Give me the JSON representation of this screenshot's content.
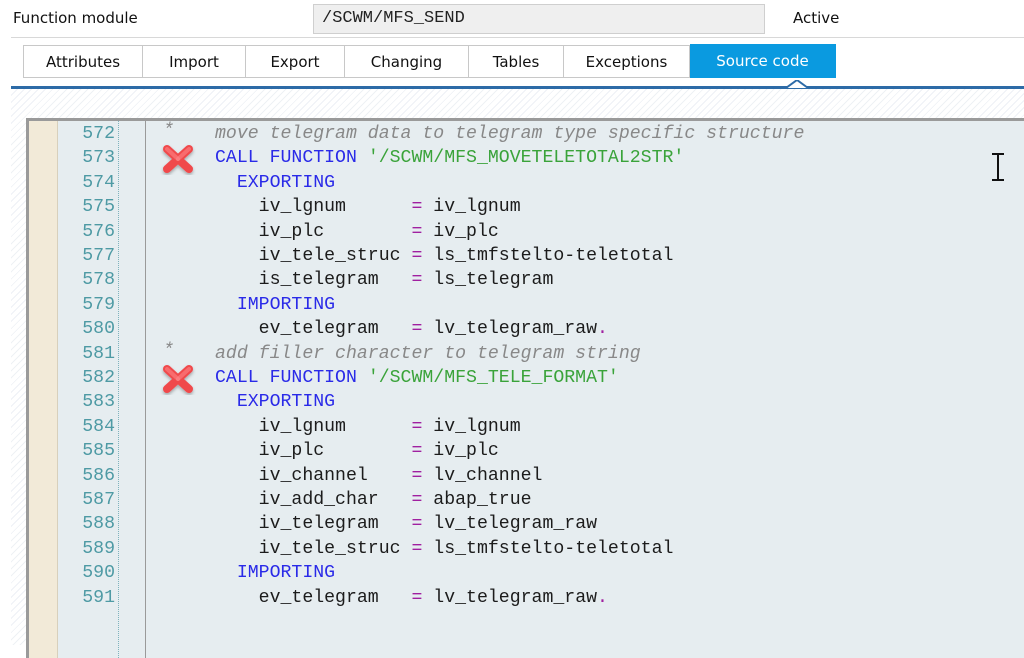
{
  "header": {
    "label": "Function module",
    "module_name": "/SCWM/MFS_SEND",
    "status": "Active"
  },
  "tabs": [
    {
      "label": "Attributes",
      "active": false
    },
    {
      "label": "Import",
      "active": false
    },
    {
      "label": "Export",
      "active": false
    },
    {
      "label": "Changing",
      "active": false
    },
    {
      "label": "Tables",
      "active": false
    },
    {
      "label": "Exceptions",
      "active": false
    },
    {
      "label": "Source code",
      "active": true
    }
  ],
  "colors": {
    "active_tab": "#0a9ae0",
    "tab_underline": "#2d6ba7",
    "keyword": "#2a2ae8",
    "string": "#3aa33a",
    "comment": "#888888",
    "operator": "#a020a0",
    "line_number": "#4e9aa4",
    "breakpoint": "#f0484c"
  },
  "editor": {
    "lines": [
      {
        "num": "572",
        "comment_star": true,
        "breakpoint": false,
        "tokens": [
          {
            "t": "cmt",
            "v": "move telegram data to telegram type specific structure"
          }
        ]
      },
      {
        "num": "573",
        "comment_star": false,
        "breakpoint": true,
        "tokens": [
          {
            "t": "kw",
            "v": "CALL FUNCTION "
          },
          {
            "t": "str",
            "v": "'/SCWM/MFS_MOVETELETOTAL2STR'"
          }
        ]
      },
      {
        "num": "574",
        "comment_star": false,
        "breakpoint": false,
        "tokens": [
          {
            "t": "kw",
            "v": "  EXPORTING"
          }
        ]
      },
      {
        "num": "575",
        "comment_star": false,
        "breakpoint": false,
        "tokens": [
          {
            "t": "id",
            "v": "    iv_lgnum      "
          },
          {
            "t": "op",
            "v": "="
          },
          {
            "t": "id",
            "v": " iv_lgnum"
          }
        ]
      },
      {
        "num": "576",
        "comment_star": false,
        "breakpoint": false,
        "tokens": [
          {
            "t": "id",
            "v": "    iv_plc        "
          },
          {
            "t": "op",
            "v": "="
          },
          {
            "t": "id",
            "v": " iv_plc"
          }
        ]
      },
      {
        "num": "577",
        "comment_star": false,
        "breakpoint": false,
        "tokens": [
          {
            "t": "id",
            "v": "    iv_tele_struc "
          },
          {
            "t": "op",
            "v": "="
          },
          {
            "t": "id",
            "v": " ls_tmfstelto-teletotal"
          }
        ]
      },
      {
        "num": "578",
        "comment_star": false,
        "breakpoint": false,
        "tokens": [
          {
            "t": "id",
            "v": "    is_telegram   "
          },
          {
            "t": "op",
            "v": "="
          },
          {
            "t": "id",
            "v": " ls_telegram"
          }
        ]
      },
      {
        "num": "579",
        "comment_star": false,
        "breakpoint": false,
        "tokens": [
          {
            "t": "kw",
            "v": "  IMPORTING"
          }
        ]
      },
      {
        "num": "580",
        "comment_star": false,
        "breakpoint": false,
        "tokens": [
          {
            "t": "id",
            "v": "    ev_telegram   "
          },
          {
            "t": "op",
            "v": "="
          },
          {
            "t": "id",
            "v": " lv_telegram_raw"
          },
          {
            "t": "op",
            "v": "."
          }
        ]
      },
      {
        "num": "581",
        "comment_star": true,
        "breakpoint": false,
        "tokens": [
          {
            "t": "cmt",
            "v": "add filler character to telegram string"
          }
        ]
      },
      {
        "num": "582",
        "comment_star": false,
        "breakpoint": true,
        "tokens": [
          {
            "t": "kw",
            "v": "CALL FUNCTION "
          },
          {
            "t": "str",
            "v": "'/SCWM/MFS_TELE_FORMAT'"
          }
        ]
      },
      {
        "num": "583",
        "comment_star": false,
        "breakpoint": false,
        "tokens": [
          {
            "t": "kw",
            "v": "  EXPORTING"
          }
        ]
      },
      {
        "num": "584",
        "comment_star": false,
        "breakpoint": false,
        "tokens": [
          {
            "t": "id",
            "v": "    iv_lgnum      "
          },
          {
            "t": "op",
            "v": "="
          },
          {
            "t": "id",
            "v": " iv_lgnum"
          }
        ]
      },
      {
        "num": "585",
        "comment_star": false,
        "breakpoint": false,
        "tokens": [
          {
            "t": "id",
            "v": "    iv_plc        "
          },
          {
            "t": "op",
            "v": "="
          },
          {
            "t": "id",
            "v": " iv_plc"
          }
        ]
      },
      {
        "num": "586",
        "comment_star": false,
        "breakpoint": false,
        "tokens": [
          {
            "t": "id",
            "v": "    iv_channel    "
          },
          {
            "t": "op",
            "v": "="
          },
          {
            "t": "id",
            "v": " lv_channel"
          }
        ]
      },
      {
        "num": "587",
        "comment_star": false,
        "breakpoint": false,
        "tokens": [
          {
            "t": "id",
            "v": "    iv_add_char   "
          },
          {
            "t": "op",
            "v": "="
          },
          {
            "t": "id",
            "v": " abap_true"
          }
        ]
      },
      {
        "num": "588",
        "comment_star": false,
        "breakpoint": false,
        "tokens": [
          {
            "t": "id",
            "v": "    iv_telegram   "
          },
          {
            "t": "op",
            "v": "="
          },
          {
            "t": "id",
            "v": " lv_telegram_raw"
          }
        ]
      },
      {
        "num": "589",
        "comment_star": false,
        "breakpoint": false,
        "tokens": [
          {
            "t": "id",
            "v": "    iv_tele_struc "
          },
          {
            "t": "op",
            "v": "="
          },
          {
            "t": "id",
            "v": " ls_tmfstelto-teletotal"
          }
        ]
      },
      {
        "num": "590",
        "comment_star": false,
        "breakpoint": false,
        "tokens": [
          {
            "t": "kw",
            "v": "  IMPORTING"
          }
        ]
      },
      {
        "num": "591",
        "comment_star": false,
        "breakpoint": false,
        "tokens": [
          {
            "t": "id",
            "v": "    ev_telegram   "
          },
          {
            "t": "op",
            "v": "="
          },
          {
            "t": "id",
            "v": " lv_telegram_raw"
          },
          {
            "t": "op",
            "v": "."
          }
        ]
      }
    ]
  },
  "cursor": {
    "icon": "text-cursor-ibeam-icon"
  },
  "breakpoint_icon": "delete-breakpoint-x-icon"
}
